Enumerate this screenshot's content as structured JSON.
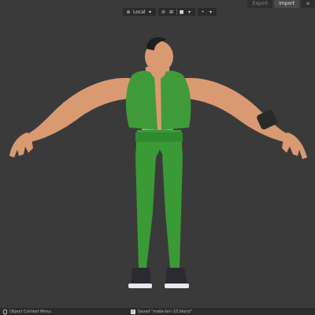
{
  "toolbar": {
    "transform_orientation": "Local",
    "icons": [
      "orientation-icon",
      "pivot-icon",
      "snap-icon",
      "proportional-icon",
      "overlay-icon"
    ]
  },
  "header": {
    "export_label": "Export",
    "import_label": "Import"
  },
  "statusbar": {
    "context_menu_label": "Object Context Menu",
    "saved_message": "Saved \"make-bm-10.blend\""
  },
  "colors": {
    "background": "#3a3a3a",
    "skin": "#d99a72",
    "vest": "#3f9a3a",
    "pants": "#3a9a35",
    "shoe": "#2a2a30"
  }
}
